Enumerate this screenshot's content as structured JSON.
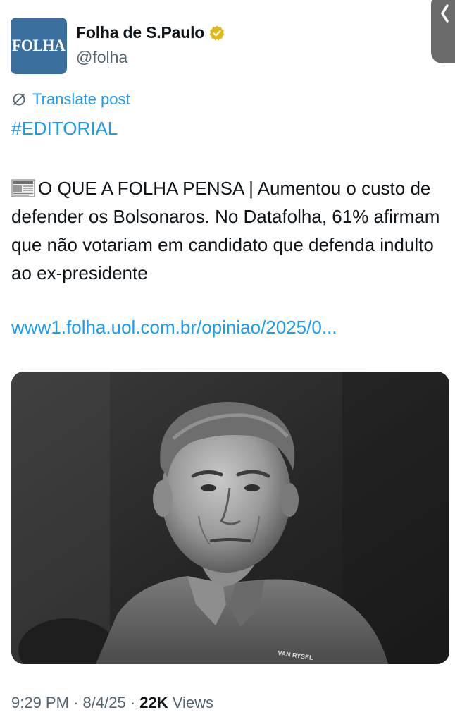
{
  "author": {
    "avatar_text": "FOLHA",
    "display_name": "Folha de S.Paulo",
    "handle": "@folha",
    "verified": true,
    "verified_color": "#e2b719"
  },
  "post": {
    "translate_label": "Translate post",
    "hashtag": "#EDITORIAL",
    "body": "O QUE A FOLHA PENSA | Aumentou o custo de defender os Bolsonaros. No Datafolha, 61% afirmam que não votariam em candidato que defenda indulto ao ex-presidente",
    "leading_emoji": "newspaper-icon",
    "link": "www1.folha.uol.com.br/opiniao/2025/0...",
    "image_caption_on_shirt": "VAN RYSEL"
  },
  "meta": {
    "time": "9:29 PM",
    "separator": "·",
    "date": "8/4/25",
    "views_count": "22K",
    "views_label": "Views"
  },
  "colors": {
    "link": "#1d9bf0",
    "secondary_text": "#536471",
    "primary_text": "#0f1419",
    "avatar_bg": "#3a6e9d"
  }
}
